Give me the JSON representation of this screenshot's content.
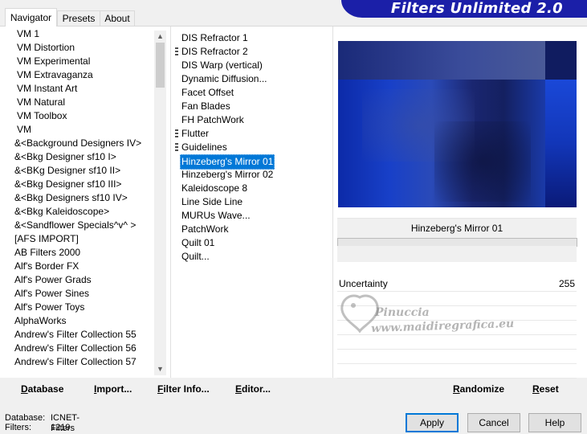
{
  "tabs": [
    "Navigator",
    "Presets",
    "About"
  ],
  "banner_title": "Filters Unlimited 2.0",
  "categories": [
    "VM 1",
    "VM Distortion",
    "VM Experimental",
    "VM Extravaganza",
    "VM Instant Art",
    "VM Natural",
    "VM Toolbox",
    "VM",
    "&<Background Designers IV>",
    "&<Bkg Designer sf10 I>",
    "&<BKg Designer sf10 II>",
    "&<Bkg Designer sf10 III>",
    "&<Bkg Designers sf10 IV>",
    "&<Bkg Kaleidoscope>",
    "&<Sandflower Specials^v^ >",
    "[AFS IMPORT]",
    "AB Filters 2000",
    "Alf's Border FX",
    "Alf's Power Grads",
    "Alf's Power Sines",
    "Alf's Power Toys",
    "AlphaWorks",
    "Andrew's Filter Collection 55",
    "Andrew's Filter Collection 56",
    "Andrew's Filter Collection 57"
  ],
  "filters": [
    "DIS Refractor 1",
    "DIS Refractor 2",
    "DIS Warp (vertical)",
    "Dynamic Diffusion...",
    "Facet Offset",
    "Fan Blades",
    "FH PatchWork",
    "Flutter",
    "Guidelines",
    "Hinzeberg's Mirror 01",
    "Hinzeberg's Mirror 02",
    "Kaleidoscope 8",
    "Line Side Line",
    "MURUs Wave...",
    "PatchWork",
    "Quilt 01",
    "Quilt..."
  ],
  "selected_filter_name": "Hinzeberg's Mirror 01",
  "param": {
    "name": "Uncertainty",
    "value": "255"
  },
  "watermark": {
    "line1": "Pinuccia",
    "line2": "www.maidiregrafica.eu"
  },
  "toolbar": {
    "database": "Database",
    "import": "Import...",
    "filter_info": "Filter Info...",
    "editor": "Editor...",
    "randomize": "Randomize",
    "reset": "Reset"
  },
  "status": {
    "database_label": "Database:",
    "database_value": "ICNET-Filters",
    "filters_label": "Filters:",
    "filters_value": "1219"
  },
  "buttons": {
    "apply": "Apply",
    "cancel": "Cancel",
    "help": "Help"
  },
  "colors": {
    "selection": "#0078d7",
    "banner": "#1b1fa8"
  }
}
